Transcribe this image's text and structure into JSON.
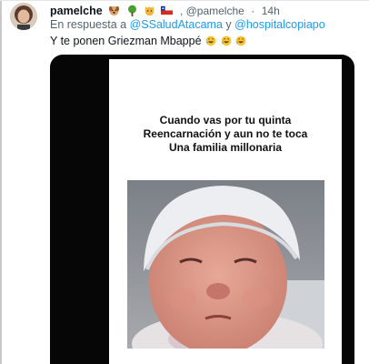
{
  "tweet": {
    "author_name": "pamelche",
    "author_handle": "@pamelche",
    "time": "14h",
    "separator": "·",
    "reply_prefix": "En respuesta a",
    "reply_mention_1": "@SSaludAtacama",
    "reply_joiner": "y",
    "reply_mention_2": "@hospitalcopiapo",
    "text": "Y te ponen Griezman Mbappé",
    "name_icons": [
      "dog-emoji",
      "tree-emoji",
      "cat-emoji",
      "chile-flag-emoji"
    ],
    "text_icons": [
      "rolling-laughing-emoji",
      "rolling-laughing-emoji",
      "rolling-laughing-emoji"
    ]
  },
  "media": {
    "caption_lines": [
      "Cuando vas  por tu quinta",
      "Reencarnación y aun no te toca",
      "Una familia millonaria"
    ]
  },
  "colors": {
    "text": "#0f1419",
    "secondary": "#536471",
    "link": "#1d9bf0",
    "media_bg": "#060606"
  }
}
